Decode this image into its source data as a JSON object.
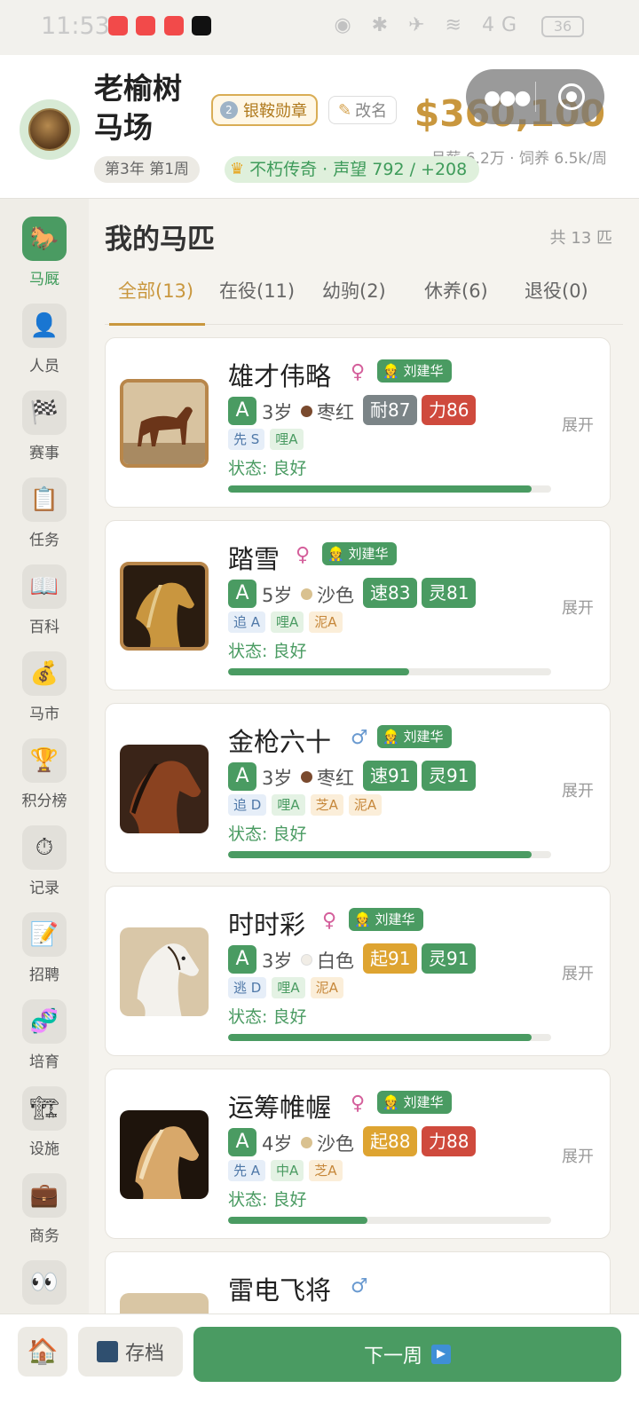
{
  "statusbar": {
    "time": "11:53",
    "battery": "36",
    "signal": "4G"
  },
  "header": {
    "ranch_name": "老榆树马场",
    "medal": "银鞍勋章",
    "rename": "改名",
    "money": "$360,100",
    "wages": "月薪 6.2万 · 饲养 6.5k/周",
    "week": "第3年 第1周",
    "legend": "不朽传奇 · 声望 792 / +208"
  },
  "sidebar": {
    "items": [
      {
        "label": "马厩",
        "icon": "horse-icon",
        "active": true
      },
      {
        "label": "人员",
        "icon": "person-icon"
      },
      {
        "label": "赛事",
        "icon": "checkered-flag-icon"
      },
      {
        "label": "任务",
        "icon": "clipboard-icon"
      },
      {
        "label": "百科",
        "icon": "book-icon"
      },
      {
        "label": "马市",
        "icon": "money-bag-icon"
      },
      {
        "label": "积分榜",
        "icon": "trophy-icon"
      },
      {
        "label": "记录",
        "icon": "stopwatch-icon"
      },
      {
        "label": "招聘",
        "icon": "memo-icon"
      },
      {
        "label": "培育",
        "icon": "dna-icon"
      },
      {
        "label": "设施",
        "icon": "crane-icon"
      },
      {
        "label": "商务",
        "icon": "briefcase-icon"
      },
      {
        "label": "",
        "icon": "eyes-icon"
      }
    ]
  },
  "main": {
    "title": "我的马匹",
    "count": "共 13 匹",
    "tabs": [
      "全部(13)",
      "在役(11)",
      "幼驹(2)",
      "休养(6)",
      "退役(0)"
    ],
    "expand_label": "展开",
    "horses": [
      {
        "name": "雄才伟略",
        "sex": "♀",
        "trainer": "刘建华",
        "grade": "A",
        "age": "3岁",
        "coat": "枣红",
        "coat_color": "#7a4a2e",
        "stats": [
          {
            "label": "耐87",
            "color": "gray"
          },
          {
            "label": "力86",
            "color": "red"
          }
        ],
        "tags": [
          {
            "label": "先 S",
            "color": "blue"
          },
          {
            "label": "哩A",
            "color": "green"
          }
        ],
        "status": "状态: 良好",
        "condition": 0.94
      },
      {
        "name": "踏雪",
        "sex": "♀",
        "trainer": "刘建华",
        "grade": "A",
        "age": "5岁",
        "coat": "沙色",
        "coat_color": "#d9c190",
        "stats": [
          {
            "label": "速83",
            "color": "green"
          },
          {
            "label": "灵81",
            "color": "green"
          }
        ],
        "tags": [
          {
            "label": "追 A",
            "color": "blue"
          },
          {
            "label": "哩A",
            "color": "green"
          },
          {
            "label": "泥A",
            "color": "orange"
          }
        ],
        "status": "状态: 良好",
        "condition": 0.56
      },
      {
        "name": "金枪六十",
        "sex": "♂",
        "trainer": "刘建华",
        "grade": "A",
        "age": "3岁",
        "coat": "枣红",
        "coat_color": "#7a4a2e",
        "stats": [
          {
            "label": "速91",
            "color": "green"
          },
          {
            "label": "灵91",
            "color": "green"
          }
        ],
        "tags": [
          {
            "label": "追 D",
            "color": "blue"
          },
          {
            "label": "哩A",
            "color": "green"
          },
          {
            "label": "芝A",
            "color": "orange"
          },
          {
            "label": "泥A",
            "color": "orange"
          }
        ],
        "status": "状态: 良好",
        "condition": 0.94
      },
      {
        "name": "时时彩",
        "sex": "♀",
        "trainer": "刘建华",
        "grade": "A",
        "age": "3岁",
        "coat": "白色",
        "coat_color": "#f1ede6",
        "stats": [
          {
            "label": "起91",
            "color": "gold"
          },
          {
            "label": "灵91",
            "color": "green"
          }
        ],
        "tags": [
          {
            "label": "逃 D",
            "color": "blue"
          },
          {
            "label": "哩A",
            "color": "green"
          },
          {
            "label": "泥A",
            "color": "orange"
          }
        ],
        "status": "状态: 良好",
        "condition": 0.94
      },
      {
        "name": "运筹帷幄",
        "sex": "♀",
        "trainer": "刘建华",
        "grade": "A",
        "age": "4岁",
        "coat": "沙色",
        "coat_color": "#d9c190",
        "stats": [
          {
            "label": "起88",
            "color": "gold"
          },
          {
            "label": "力88",
            "color": "red"
          }
        ],
        "tags": [
          {
            "label": "先 A",
            "color": "blue"
          },
          {
            "label": "中A",
            "color": "green"
          },
          {
            "label": "芝A",
            "color": "orange"
          }
        ],
        "status": "状态: 良好",
        "condition": 0.43
      },
      {
        "name": "雷电飞将",
        "sex": "♂"
      }
    ]
  },
  "bottombar": {
    "save": "存档",
    "next": "下一周"
  }
}
